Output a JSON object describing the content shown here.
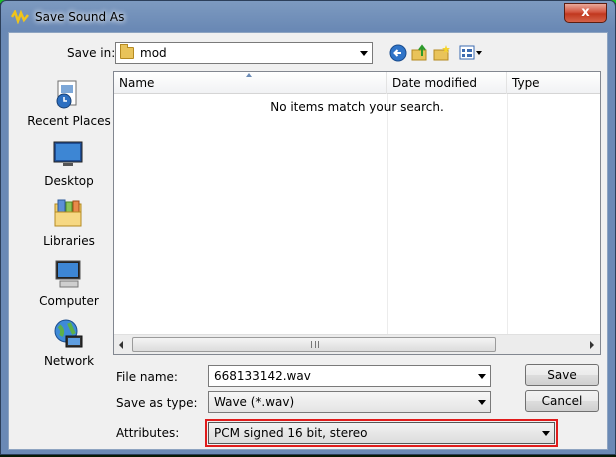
{
  "window": {
    "title": "Save Sound As",
    "close_label": "x"
  },
  "save_in": {
    "label": "Save in:",
    "folder": "mod"
  },
  "places": [
    {
      "label": "Recent Places",
      "icon": "recent-places-icon"
    },
    {
      "label": "Desktop",
      "icon": "desktop-icon"
    },
    {
      "label": "Libraries",
      "icon": "libraries-icon"
    },
    {
      "label": "Computer",
      "icon": "computer-icon"
    },
    {
      "label": "Network",
      "icon": "network-icon"
    }
  ],
  "file_list": {
    "columns": [
      "Name",
      "Date modified",
      "Type"
    ],
    "empty_message": "No items match your search."
  },
  "form": {
    "file_name_label": "File name:",
    "file_name_value": "668133142.wav",
    "save_type_label": "Save as type:",
    "save_type_value": "Wave (*.wav)",
    "attributes_label": "Attributes:",
    "attributes_value": "PCM signed 16 bit, stereo"
  },
  "buttons": {
    "save": "Save",
    "cancel": "Cancel"
  },
  "colors": {
    "highlight": "#e01b1b",
    "titlebar": "#6a89b5"
  }
}
